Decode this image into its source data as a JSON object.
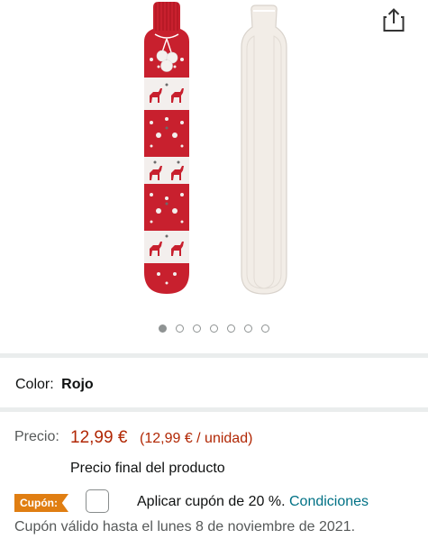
{
  "gallery": {
    "share_icon": "share-icon",
    "slide_count": 7,
    "active_slide": 1
  },
  "color": {
    "label": "Color:",
    "value": "Rojo"
  },
  "price": {
    "label": "Precio:",
    "main": "12,99 €",
    "per_unit": "(12,99 € / unidad)",
    "final_note": "Precio final del producto"
  },
  "coupon": {
    "badge": "Cupón:",
    "apply_text": "Aplicar cupón de 20 %.",
    "conditions_link": "Condiciones",
    "validity": "Cupón válido hasta el lunes 8 de noviembre de 2021.",
    "checked": false
  },
  "colors": {
    "price": "#b12704",
    "link": "#007185",
    "coupon_badge": "#e07e12",
    "knit_red": "#c8202e"
  }
}
